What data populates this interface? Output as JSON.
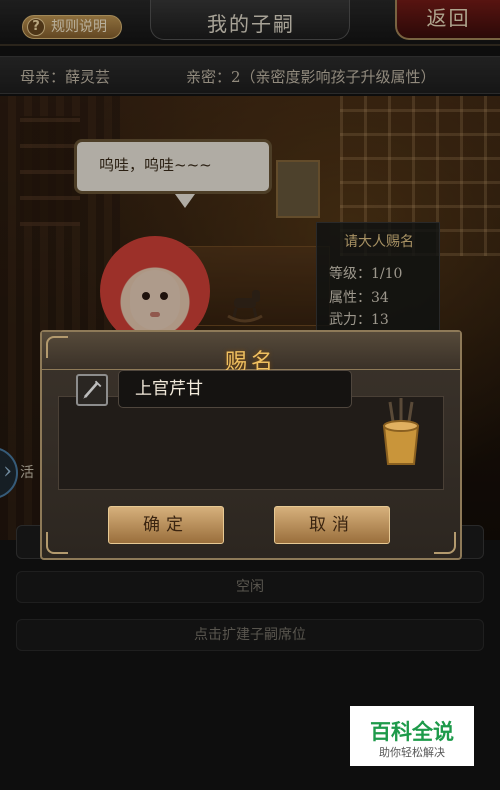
{
  "header": {
    "rules_label": "规则说明",
    "title": "我的子嗣",
    "back_label": "返回"
  },
  "info": {
    "mother": "母亲：薛灵芸",
    "intimacy": "亲密：2（亲密度影响孩子升级属性）"
  },
  "scene": {
    "speech": "呜哇，呜哇~~~"
  },
  "stats": {
    "title": "请大人赐名",
    "rows": [
      {
        "label": "等级：",
        "value": "1/10"
      },
      {
        "label": "属性：",
        "value": "34"
      },
      {
        "label": "武力：",
        "value": "13"
      }
    ]
  },
  "side": {
    "text": "活"
  },
  "slots": {
    "idle_label": "空闲",
    "expand_label": "点击扩建子嗣席位"
  },
  "modal": {
    "title": "赐名",
    "name_value": "上官芹甘",
    "confirm_label": "确定",
    "cancel_label": "取消"
  },
  "watermark": {
    "brand": "百科全说",
    "tagline": "助你轻松解决"
  },
  "colors": {
    "accent_gold": "#f0c060",
    "button_tan": "#d6b07c",
    "back_red": "#7a1c18",
    "watermark_green": "#1d9a4a"
  }
}
